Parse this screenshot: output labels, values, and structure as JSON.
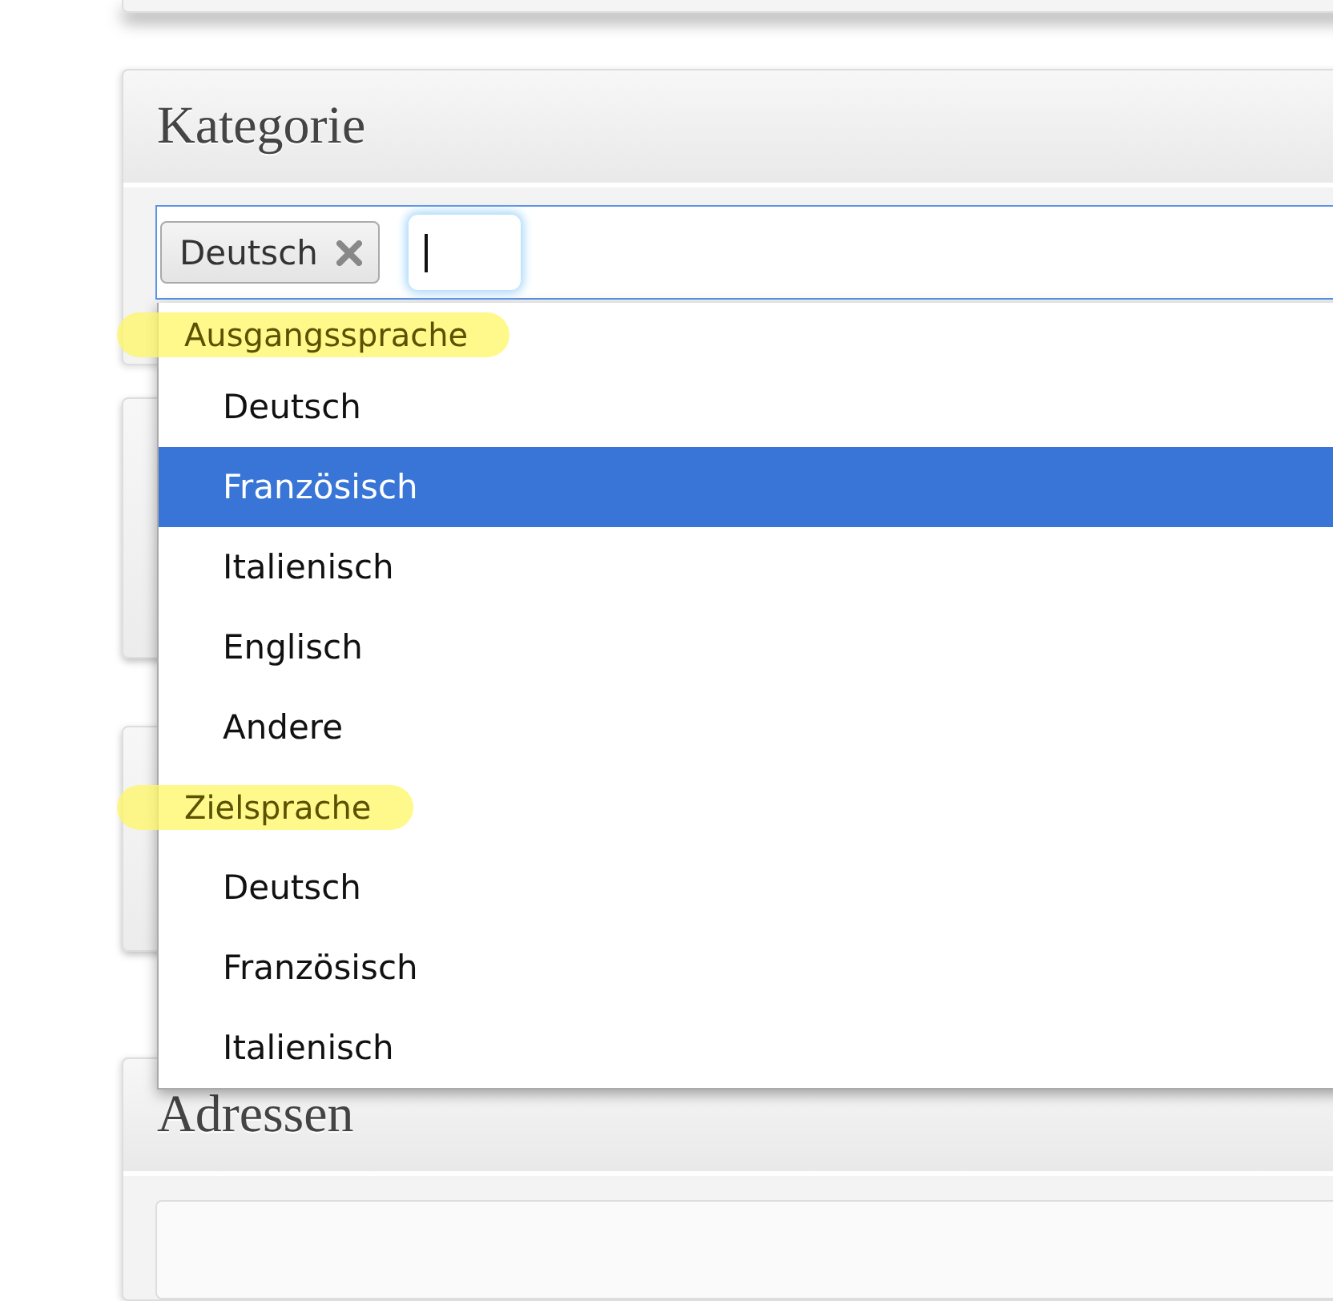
{
  "category_panel": {
    "title": "Kategorie",
    "select": {
      "tags": [
        {
          "label": "Deutsch"
        }
      ],
      "groups": [
        {
          "label": "Ausgangssprache",
          "options": [
            {
              "label": "Deutsch",
              "selected": false
            },
            {
              "label": "Französisch",
              "selected": true
            },
            {
              "label": "Italienisch",
              "selected": false
            },
            {
              "label": "Englisch",
              "selected": false
            },
            {
              "label": "Andere",
              "selected": false
            }
          ]
        },
        {
          "label": "Zielsprache",
          "options": [
            {
              "label": "Deutsch",
              "selected": false
            },
            {
              "label": "Französisch",
              "selected": false
            },
            {
              "label": "Italienisch",
              "selected": false
            }
          ]
        }
      ]
    }
  },
  "addresses_panel": {
    "title": "Adressen"
  }
}
